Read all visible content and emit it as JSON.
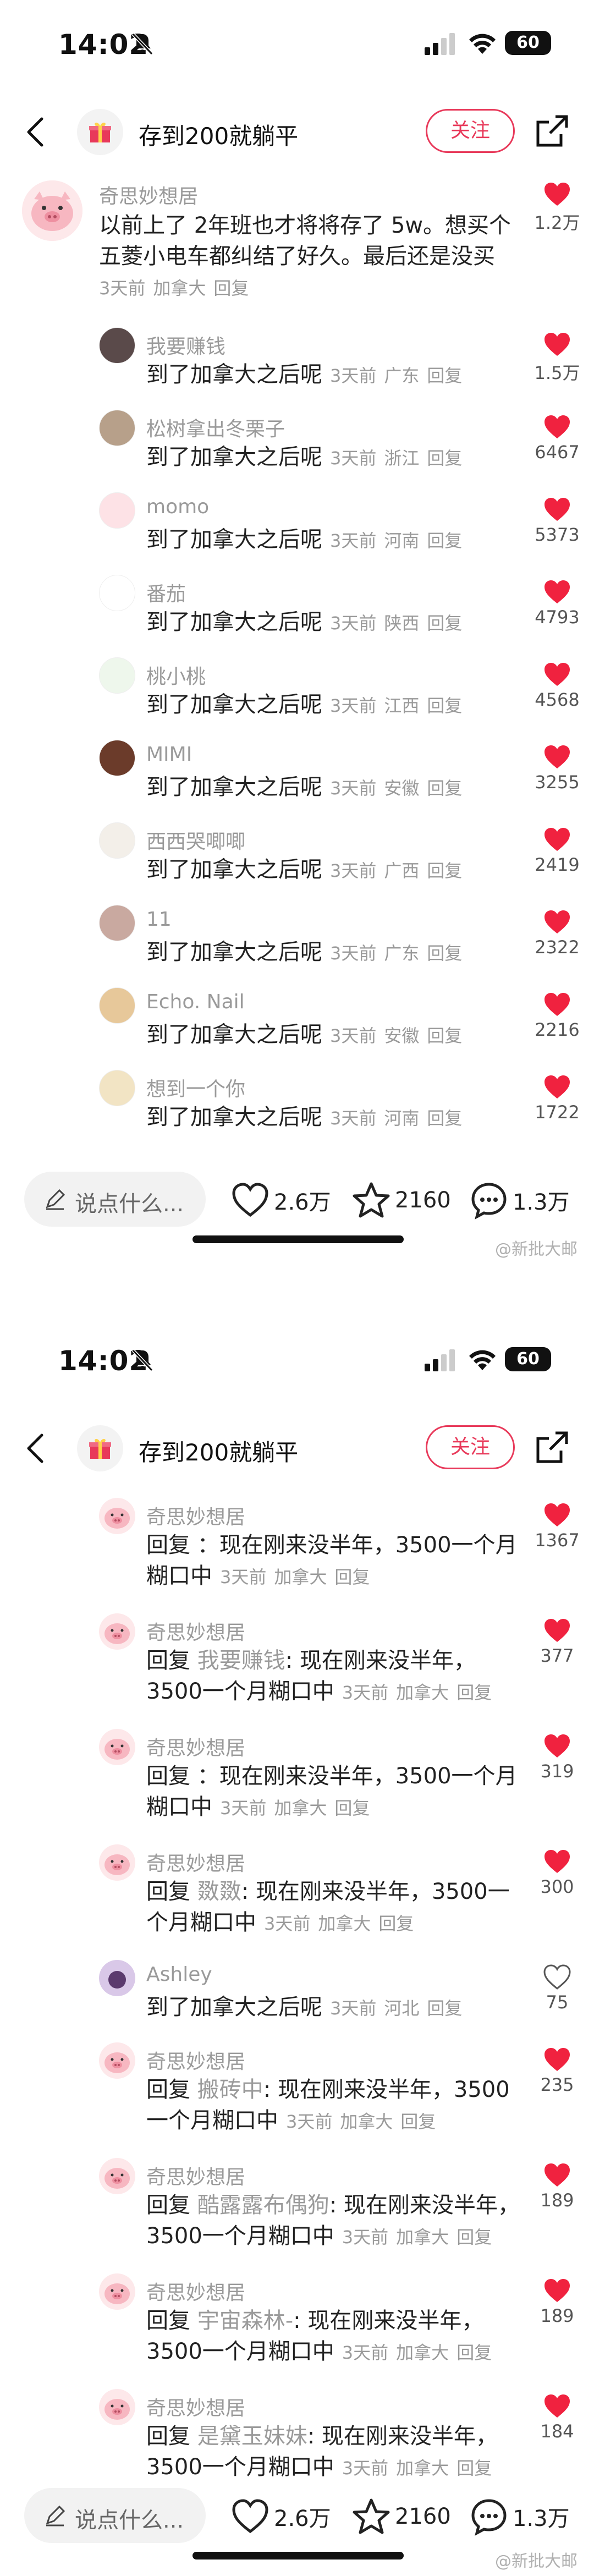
{
  "status": {
    "time": "14:02",
    "battery": "60"
  },
  "header": {
    "title": "存到200就躺平",
    "follow": "关注"
  },
  "bottom": {
    "placeholder": "说点什么...",
    "likes": "2.6万",
    "stars": "2160",
    "comments": "1.3万"
  },
  "watermark": "@新批大邮",
  "screen1": {
    "main": {
      "user": "奇思妙想居",
      "line1": "以前上了 2年班也才将将存了 5w。想买个",
      "line2": "五菱小电车都纠结了好久。最后还是没买",
      "time": "3天前",
      "loc": "加拿大",
      "reply": "回复",
      "likes": "1.2万"
    },
    "replies": [
      {
        "user": "我要赚钱",
        "text": "到了加拿大之后呢",
        "time": "3天前",
        "loc": "广东",
        "reply": "回复",
        "likes": "1.5万"
      },
      {
        "user": "松树拿出冬栗子",
        "text": "到了加拿大之后呢",
        "time": "3天前",
        "loc": "浙江",
        "reply": "回复",
        "likes": "6467"
      },
      {
        "user": "momo",
        "text": "到了加拿大之后呢",
        "time": "3天前",
        "loc": "河南",
        "reply": "回复",
        "likes": "5373"
      },
      {
        "user": "番茄",
        "text": "到了加拿大之后呢",
        "time": "3天前",
        "loc": "陕西",
        "reply": "回复",
        "likes": "4793"
      },
      {
        "user": "桃小桃",
        "text": "到了加拿大之后呢",
        "time": "3天前",
        "loc": "江西",
        "reply": "回复",
        "likes": "4568"
      },
      {
        "user": "MIMI",
        "text": "到了加拿大之后呢",
        "time": "3天前",
        "loc": "安徽",
        "reply": "回复",
        "likes": "3255"
      },
      {
        "user": "西西哭唧唧",
        "text": "到了加拿大之后呢",
        "time": "3天前",
        "loc": "广西",
        "reply": "回复",
        "likes": "2419"
      },
      {
        "user": "11",
        "text": "到了加拿大之后呢",
        "time": "3天前",
        "loc": "广东",
        "reply": "回复",
        "likes": "2322"
      },
      {
        "user": "Echo. Nail",
        "text": "到了加拿大之后呢",
        "time": "3天前",
        "loc": "安徽",
        "reply": "回复",
        "likes": "2216"
      },
      {
        "user": "想到一个你",
        "text": "到了加拿大之后呢",
        "time": "3天前",
        "loc": "河南",
        "reply": "回复",
        "likes": "1722"
      }
    ]
  },
  "screen2": {
    "replies": [
      {
        "user": "奇思妙想居",
        "rp": "回复",
        "rn": "",
        "l1": "：现在刚来没半年，3500一个月",
        "l2": "糊口中",
        "time": "3天前",
        "loc": "加拿大",
        "reply": "回复",
        "likes": "1367"
      },
      {
        "user": "奇思妙想居",
        "rp": "回复",
        "rn": "我要赚钱",
        "l1": ": 现在刚来没半年，",
        "l2": "3500一个月糊口中",
        "time": "3天前",
        "loc": "加拿大",
        "reply": "回复",
        "likes": "377"
      },
      {
        "user": "奇思妙想居",
        "rp": "回复",
        "rn": "",
        "l1": "：现在刚来没半年，3500一个月",
        "l2": "糊口中",
        "time": "3天前",
        "loc": "加拿大",
        "reply": "回复",
        "likes": "319"
      },
      {
        "user": "奇思妙想居",
        "rp": "回复",
        "rn": "敪敪",
        "l1": ": 现在刚来没半年，3500一",
        "l2": "个月糊口中",
        "time": "3天前",
        "loc": "加拿大",
        "reply": "回复",
        "likes": "300"
      },
      {
        "user": "Ashley",
        "rp": "",
        "rn": "",
        "l1": "到了加拿大之后呢",
        "l2": "",
        "time": "3天前",
        "loc": "河北",
        "reply": "回复",
        "likes": "75"
      },
      {
        "user": "奇思妙想居",
        "rp": "回复",
        "rn": "搬砖中",
        "l1": ": 现在刚来没半年，3500",
        "l2": "一个月糊口中",
        "time": "3天前",
        "loc": "加拿大",
        "reply": "回复",
        "likes": "235"
      },
      {
        "user": "奇思妙想居",
        "rp": "回复",
        "rn": "酷露露布偶狗",
        "l1": ": 现在刚来没半年，",
        "l2": "3500一个月糊口中",
        "time": "3天前",
        "loc": "加拿大",
        "reply": "回复",
        "likes": "189"
      },
      {
        "user": "奇思妙想居",
        "rp": "回复",
        "rn": "宇宙森林-",
        "l1": ": 现在刚来没半年，",
        "l2": "3500一个月糊口中",
        "time": "3天前",
        "loc": "加拿大",
        "reply": "回复",
        "likes": "189"
      },
      {
        "user": "奇思妙想居",
        "rp": "回复",
        "rn": "是黛玉妹妹",
        "l1": ": 现在刚来没半年，",
        "l2": "3500一个月糊口中",
        "time": "3天前",
        "loc": "加拿大",
        "reply": "回复",
        "likes": "184"
      }
    ]
  }
}
